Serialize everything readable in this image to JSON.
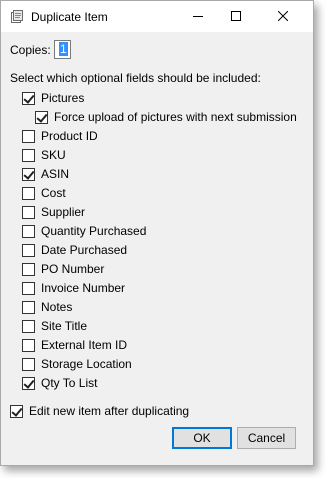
{
  "window": {
    "title": "Duplicate Item"
  },
  "copies": {
    "label": "Copies:",
    "value": "1"
  },
  "fields": {
    "label": "Select which optional fields should be included:",
    "items": [
      {
        "label": "Pictures",
        "checked": true
      },
      {
        "label": "Force upload of pictures with next submission",
        "checked": true
      },
      {
        "label": "Product ID",
        "checked": false
      },
      {
        "label": "SKU",
        "checked": false
      },
      {
        "label": "ASIN",
        "checked": true
      },
      {
        "label": "Cost",
        "checked": false
      },
      {
        "label": "Supplier",
        "checked": false
      },
      {
        "label": "Quantity Purchased",
        "checked": false
      },
      {
        "label": "Date Purchased",
        "checked": false
      },
      {
        "label": "PO Number",
        "checked": false
      },
      {
        "label": "Invoice Number",
        "checked": false
      },
      {
        "label": "Notes",
        "checked": false
      },
      {
        "label": "Site Title",
        "checked": false
      },
      {
        "label": "External Item ID",
        "checked": false
      },
      {
        "label": "Storage Location",
        "checked": false
      },
      {
        "label": "Qty To List",
        "checked": true
      }
    ]
  },
  "edit_after": {
    "label": "Edit new item after duplicating",
    "checked": true
  },
  "buttons": {
    "ok": "OK",
    "cancel": "Cancel"
  },
  "icons": {
    "app": "document-icon",
    "minimize": "minimize-icon",
    "maximize": "maximize-icon",
    "close": "close-icon"
  },
  "colors": {
    "accent": "#0078d7",
    "selection": "#3390ff",
    "dialog_bg": "#f0f0f0"
  }
}
